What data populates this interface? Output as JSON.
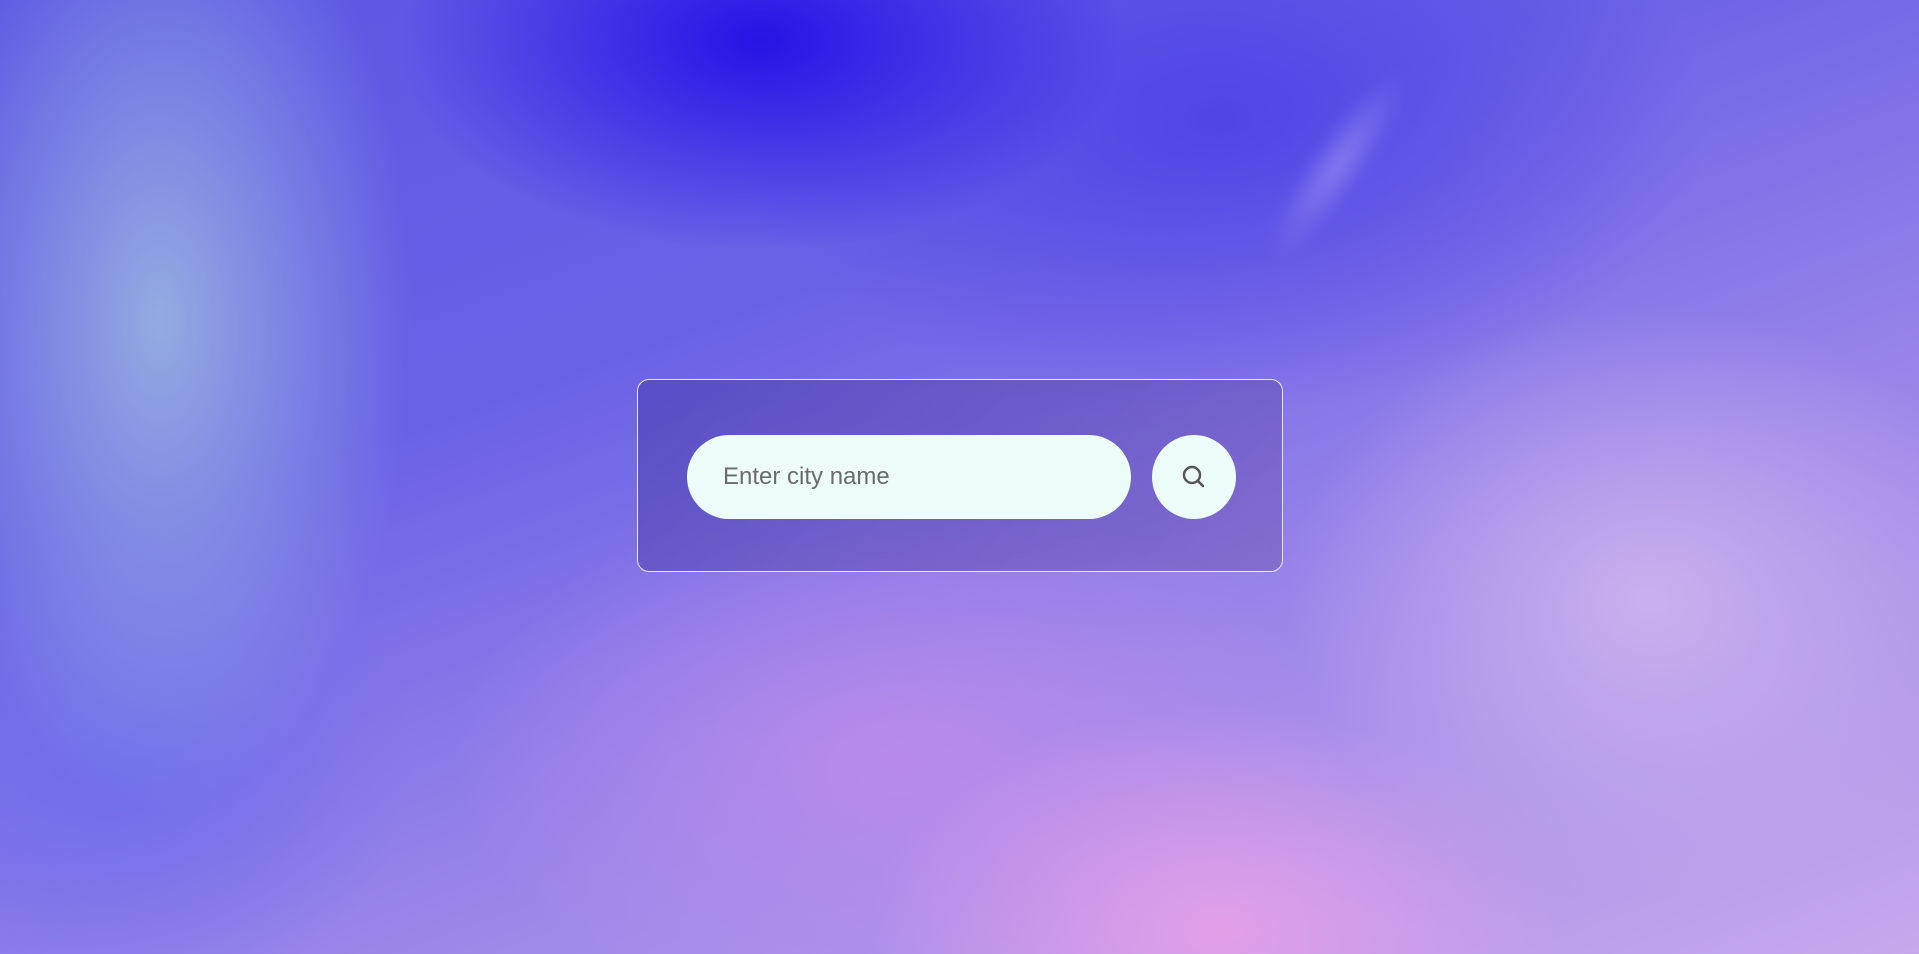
{
  "search": {
    "placeholder": "Enter city name",
    "value": ""
  },
  "search_button": {
    "icon": "search-icon"
  },
  "colors": {
    "field_background": "#ecfdfa",
    "card_border": "#ffffff",
    "icon_color": "#555555"
  }
}
